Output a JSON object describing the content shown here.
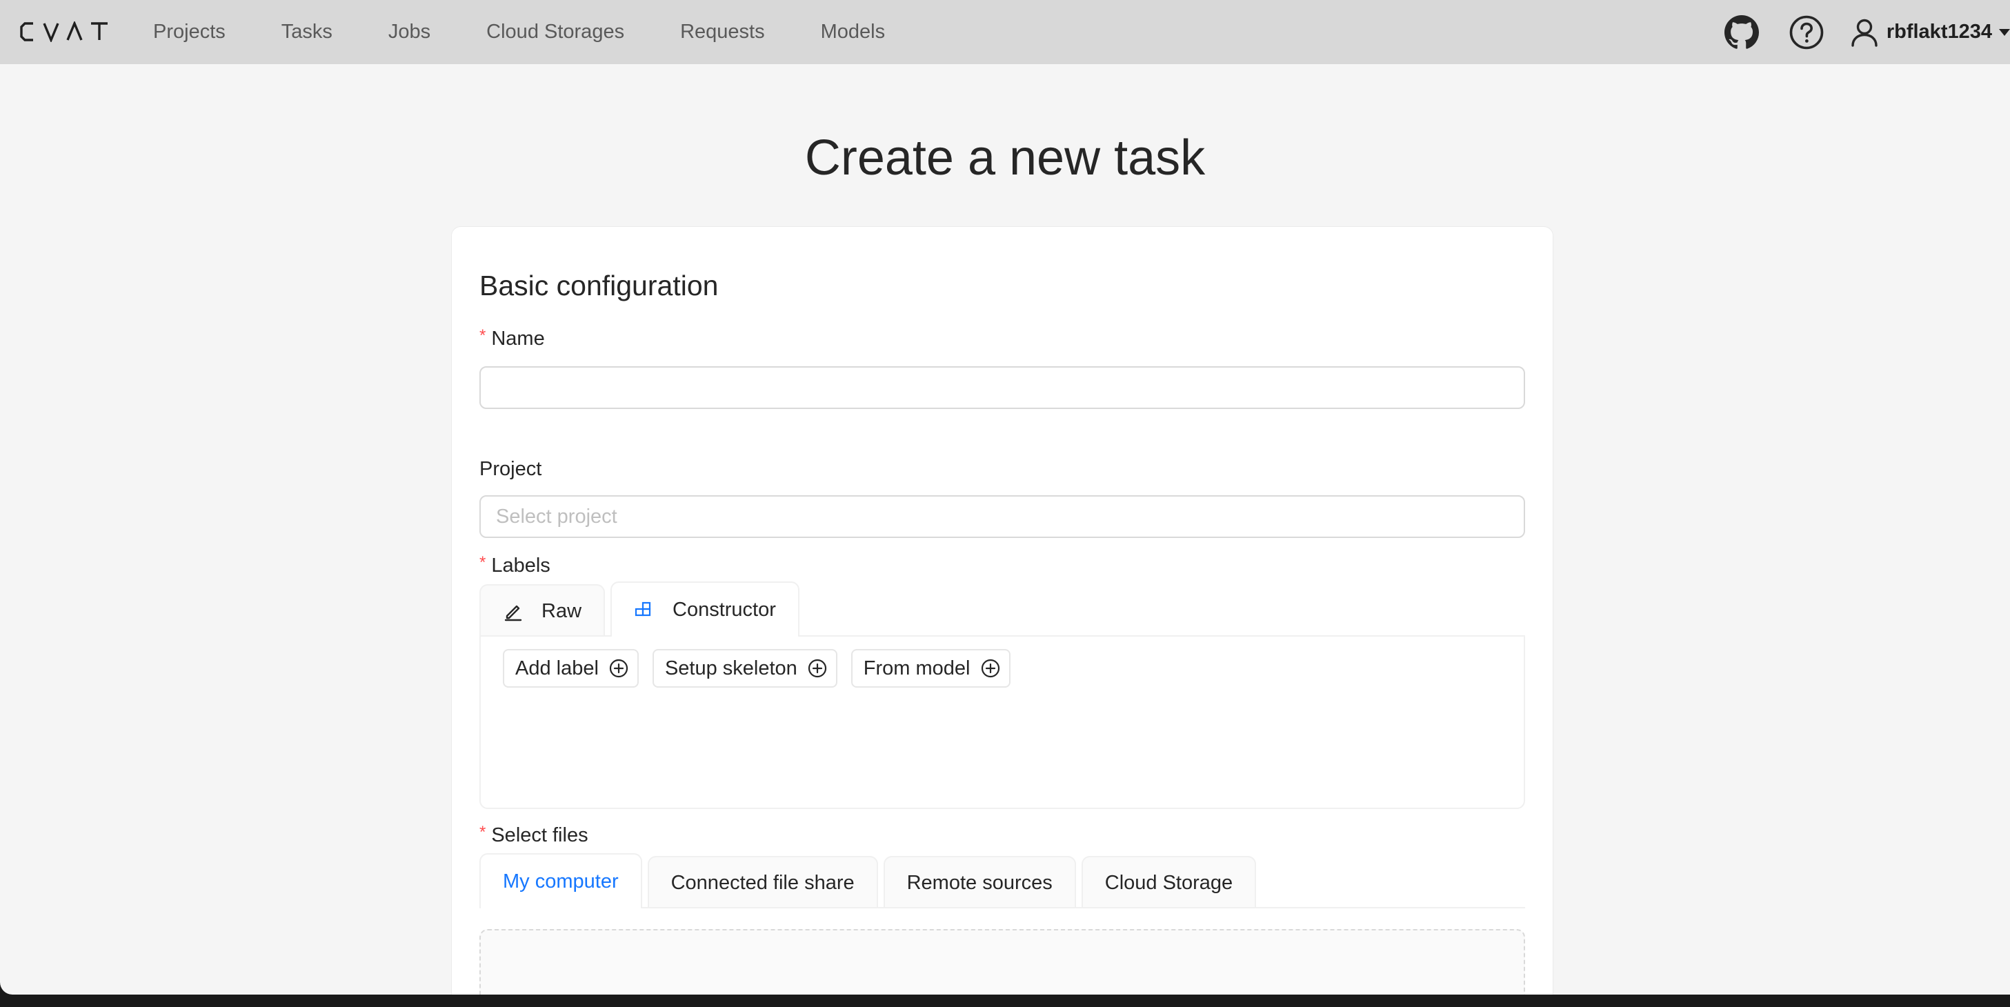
{
  "header": {
    "logo_text": "CVAT",
    "nav": [
      "Projects",
      "Tasks",
      "Jobs",
      "Cloud Storages",
      "Requests",
      "Models"
    ],
    "github_icon": "github-icon",
    "help_icon": "question-circle-icon",
    "user_icon": "user-icon",
    "username": "rbflakt1234"
  },
  "page": {
    "title": "Create a new task"
  },
  "form": {
    "section_title": "Basic configuration",
    "name": {
      "label": "Name",
      "required_mark": "*",
      "value": ""
    },
    "project": {
      "label": "Project",
      "placeholder": "Select project"
    },
    "labels": {
      "label": "Labels",
      "required_mark": "*",
      "tabs": [
        {
          "label": "Raw",
          "icon": "edit-icon"
        },
        {
          "label": "Constructor",
          "icon": "build-icon",
          "active": true
        }
      ],
      "buttons": [
        {
          "label": "Add label",
          "icon": "plus-circle-icon"
        },
        {
          "label": "Setup skeleton",
          "icon": "plus-circle-icon"
        },
        {
          "label": "From model",
          "icon": "plus-circle-icon"
        }
      ]
    },
    "files": {
      "label": "Select files",
      "required_mark": "*",
      "tabs": [
        {
          "label": "My computer",
          "active": true
        },
        {
          "label": "Connected file share"
        },
        {
          "label": "Remote sources"
        },
        {
          "label": "Cloud Storage"
        }
      ]
    }
  },
  "colors": {
    "accent": "#1677ff",
    "required": "#ff4d4f",
    "header_bg": "#d8d8d8",
    "page_bg": "#f5f5f5"
  }
}
